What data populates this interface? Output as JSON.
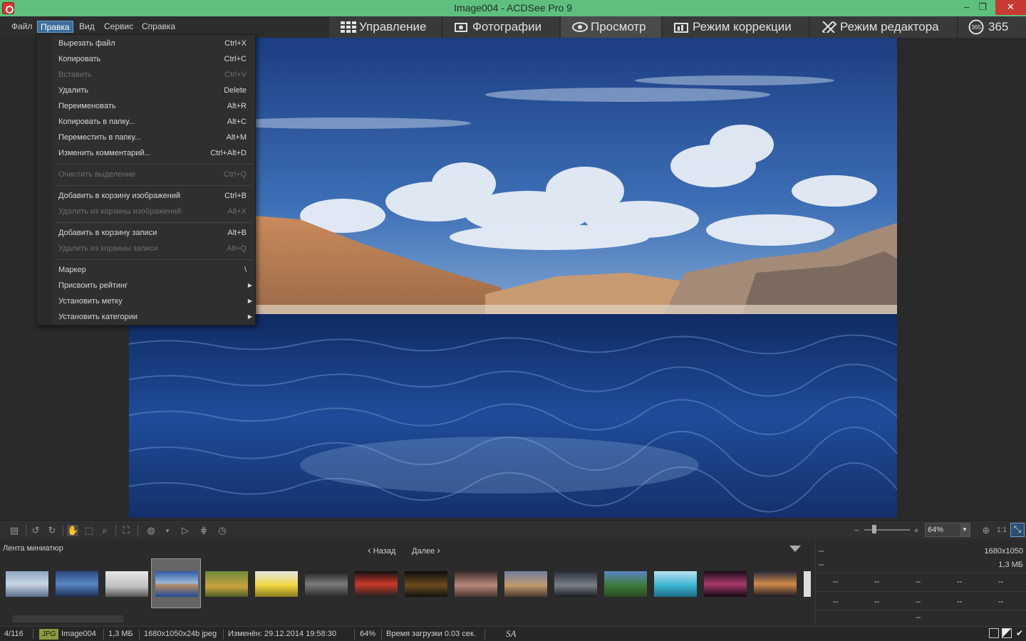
{
  "window": {
    "title": "Image004 - ACDSee Pro 9",
    "minimize": "–",
    "maximize": "❐",
    "close": "✕"
  },
  "menubar": [
    "Файл",
    "Правка",
    "Вид",
    "Сервис",
    "Справка"
  ],
  "mode_tabs": [
    {
      "label": "Управление",
      "icon": "grid-icon"
    },
    {
      "label": "Фотографии",
      "icon": "photos-icon"
    },
    {
      "label": "Просмотр",
      "icon": "eye-icon"
    },
    {
      "label": "Режим коррекции",
      "icon": "develop-icon"
    },
    {
      "label": "Режим редактора",
      "icon": "edit-icon"
    },
    {
      "label": "365",
      "icon": "365-icon"
    }
  ],
  "edit_menu": {
    "items": [
      {
        "label": "Вырезать файл",
        "shortcut": "Ctrl+X",
        "disabled": false
      },
      {
        "label": "Копировать",
        "shortcut": "Ctrl+C",
        "disabled": false
      },
      {
        "label": "Вставить",
        "shortcut": "Ctrl+V",
        "disabled": true
      },
      {
        "label": "Удалить",
        "shortcut": "Delete",
        "disabled": false
      },
      {
        "label": "Переименовать",
        "shortcut": "Alt+R",
        "disabled": false
      },
      {
        "label": "Копировать в папку...",
        "shortcut": "Alt+C",
        "disabled": false
      },
      {
        "label": "Переместить в папку...",
        "shortcut": "Alt+M",
        "disabled": false
      },
      {
        "label": "Изменить комментарий...",
        "shortcut": "Ctrl+Alt+D",
        "disabled": false
      },
      {
        "label": "Очистить выделение",
        "shortcut": "Ctrl+Q",
        "disabled": true
      },
      {
        "label": "Добавить в корзину изображений",
        "shortcut": "Ctrl+B",
        "disabled": false
      },
      {
        "label": "Удалить из корзины изображений",
        "shortcut": "Alt+X",
        "disabled": true
      },
      {
        "label": "Добавить в корзину записи",
        "shortcut": "Alt+B",
        "disabled": false
      },
      {
        "label": "Удалить из корзины записи",
        "shortcut": "Alt+Q",
        "disabled": true
      },
      {
        "label": "Маркер",
        "shortcut": "\\",
        "disabled": false
      },
      {
        "label": "Присвоить рейтинг",
        "shortcut": "",
        "disabled": false,
        "submenu": true
      },
      {
        "label": "Установить метку",
        "shortcut": "",
        "disabled": false,
        "submenu": true
      },
      {
        "label": "Установить категории",
        "shortcut": "",
        "disabled": false,
        "submenu": true
      }
    ]
  },
  "toolbar": {
    "zoom_value": "64%",
    "actual_size": "1:1"
  },
  "filmstrip": {
    "title": "Лента миниатюр",
    "back": "Назад",
    "next": "Далее"
  },
  "info_panel": {
    "left1": "--",
    "right1": "1680x1050",
    "left2": "--",
    "right2": "1,3 МБ",
    "grid_row1": [
      "--",
      "--",
      "--",
      "--",
      "--"
    ],
    "grid_row2": [
      "--",
      "--",
      "--",
      "--",
      "--"
    ],
    "bottom": "--"
  },
  "status": {
    "position": "4/116",
    "type": "JPG",
    "name": "Image004",
    "size": "1,3 МБ",
    "dims": "1680x1050x24b jpeg",
    "modified": "Изменён: 29.12.2014 19:58:30",
    "zoom": "64%",
    "load_time": "Время загрузки 0.03 сек.",
    "sa": "SA"
  },
  "colors": {
    "titlebar": "#5fbf7d",
    "menu_active": "#3d6e9c",
    "close": "#c73a33",
    "jpg_badge": "#8d9a3d"
  }
}
